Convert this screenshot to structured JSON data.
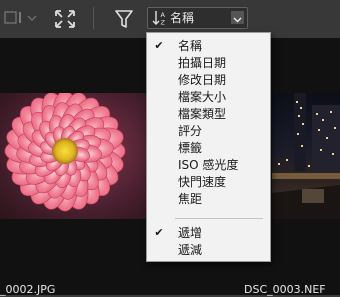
{
  "toolbar": {
    "view_icon": "list-view-icon",
    "fit_icon": "fit-screen-icon",
    "filter_icon": "filter-funnel-icon",
    "sort_icon": "sort-ascending-icon",
    "sort_label": "名稱",
    "dropdown_icon": "chevron-down-icon"
  },
  "sort_menu": {
    "fields": [
      {
        "label": "名稱",
        "checked": true
      },
      {
        "label": "拍攝日期",
        "checked": false
      },
      {
        "label": "修改日期",
        "checked": false
      },
      {
        "label": "檔案大小",
        "checked": false
      },
      {
        "label": "檔案類型",
        "checked": false
      },
      {
        "label": "評分",
        "checked": false
      },
      {
        "label": "標籤",
        "checked": false
      },
      {
        "label": "ISO 感光度",
        "checked": false
      },
      {
        "label": "快門速度",
        "checked": false
      },
      {
        "label": "焦距",
        "checked": false
      }
    ],
    "order": [
      {
        "label": "遞增",
        "checked": true
      },
      {
        "label": "遞減",
        "checked": false
      }
    ],
    "check_glyph": "✔"
  },
  "thumbnails": [
    {
      "filename": "_0002.JPG"
    },
    {
      "filename": "DSC_0003.NEF"
    }
  ]
}
